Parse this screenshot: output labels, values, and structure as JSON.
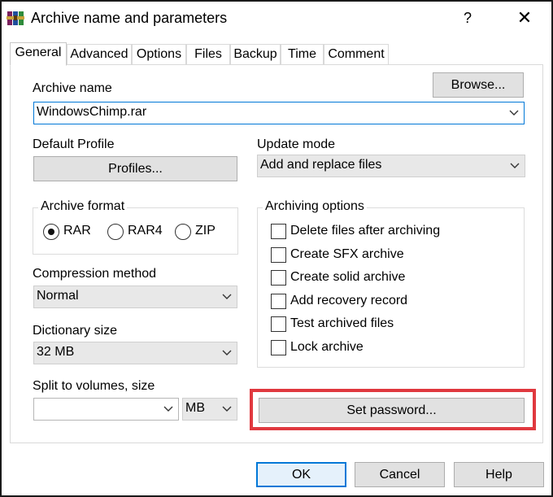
{
  "window": {
    "title": "Archive name and parameters",
    "help_glyph": "?",
    "close_glyph": "✕"
  },
  "tabs": [
    {
      "label": "General",
      "active": true
    },
    {
      "label": "Advanced"
    },
    {
      "label": "Options"
    },
    {
      "label": "Files"
    },
    {
      "label": "Backup"
    },
    {
      "label": "Time"
    },
    {
      "label": "Comment"
    }
  ],
  "general": {
    "archive_name_label": "Archive name",
    "archive_name_value": "WindowsChimp.rar",
    "browse_button": "Browse...",
    "default_profile_label": "Default Profile",
    "profiles_button": "Profiles...",
    "update_mode_label": "Update mode",
    "update_mode_value": "Add and replace files",
    "archive_format": {
      "title": "Archive format",
      "options": [
        {
          "label": "RAR",
          "checked": true
        },
        {
          "label": "RAR4",
          "checked": false
        },
        {
          "label": "ZIP",
          "checked": false
        }
      ]
    },
    "compression_method_label": "Compression method",
    "compression_method_value": "Normal",
    "dictionary_size_label": "Dictionary size",
    "dictionary_size_value": "32 MB",
    "split_label": "Split to volumes, size",
    "split_value": "",
    "split_unit": "MB",
    "archiving_options": {
      "title": "Archiving options",
      "items": [
        {
          "label": "Delete files after archiving",
          "checked": false
        },
        {
          "label": "Create SFX archive",
          "checked": false
        },
        {
          "label": "Create solid archive",
          "checked": false
        },
        {
          "label": "Add recovery record",
          "checked": false
        },
        {
          "label": "Test archived files",
          "checked": false
        },
        {
          "label": "Lock archive",
          "checked": false
        }
      ]
    },
    "set_password_button": "Set password...",
    "highlight_color": "#e0393f"
  },
  "footer": {
    "ok": "OK",
    "cancel": "Cancel",
    "help": "Help"
  },
  "colors": {
    "accent": "#0078d7",
    "button_face": "#e1e1e1"
  },
  "icons": {
    "app": "winrar-books-icon",
    "dropdown": "chevron-down-icon"
  }
}
